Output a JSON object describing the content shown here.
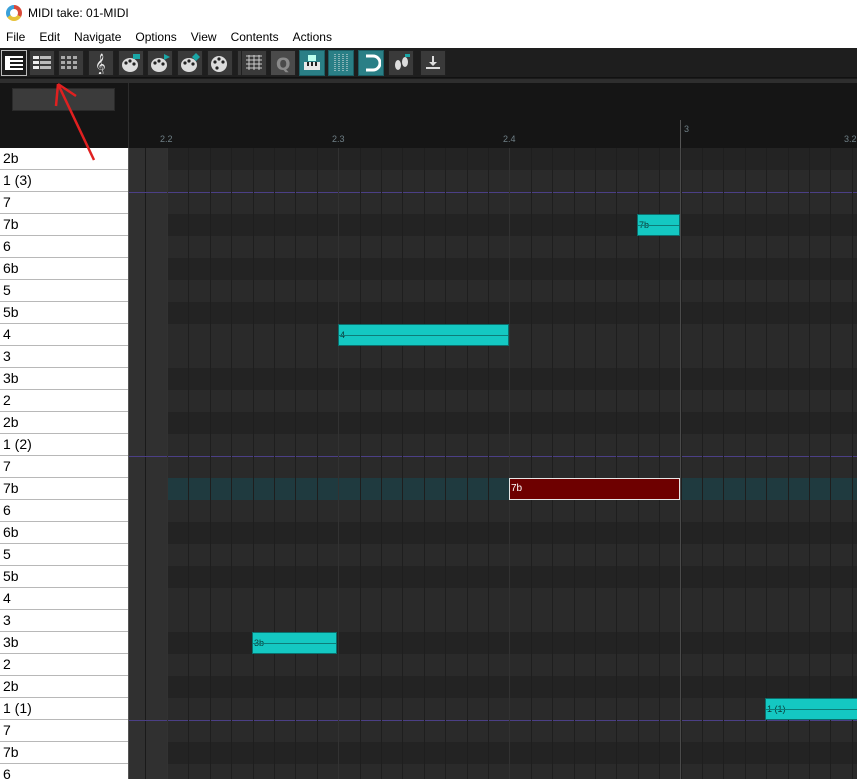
{
  "window": {
    "title": "MIDI take: 01-MIDI"
  },
  "menu": [
    "File",
    "Edit",
    "Navigate",
    "Options",
    "View",
    "Contents",
    "Actions"
  ],
  "toolbar": {
    "buttons": [
      {
        "name": "piano-roll-view",
        "icon": "piano-keys-icon"
      },
      {
        "name": "named-notes-view",
        "icon": "named-notes-icon"
      },
      {
        "name": "drum-grid-view",
        "icon": "drum-grid-icon"
      },
      {
        "name": "notation-view",
        "icon": "treble-clef-icon"
      },
      {
        "name": "midi-editor-action-1",
        "icon": "palette-icon"
      },
      {
        "name": "midi-editor-action-2",
        "icon": "palette-icon"
      },
      {
        "name": "midi-editor-action-3",
        "icon": "palette-icon"
      },
      {
        "name": "color-notes",
        "icon": "palette-icon"
      },
      {
        "name": "note-names",
        "icon": "note-names-icon"
      },
      {
        "name": "note-grid",
        "icon": "grid-icon"
      },
      {
        "name": "quantize",
        "icon": "q-icon"
      },
      {
        "name": "step-input",
        "icon": "piano-icon"
      },
      {
        "name": "grid-snap",
        "icon": "grid-lines-icon"
      },
      {
        "name": "snap-magnet",
        "icon": "magnet-icon"
      },
      {
        "name": "footprint-action",
        "icon": "footprint-icon"
      },
      {
        "name": "insert-action",
        "icon": "insert-icon"
      }
    ]
  },
  "ruler": {
    "labels": [
      "2.2",
      "2.3",
      "2.4",
      "3",
      "3.2"
    ]
  },
  "keys": [
    "2b",
    "1 (3)",
    "7",
    "7b",
    "6",
    "6b",
    "5",
    "5b",
    "4",
    "3",
    "3b",
    "2",
    "2b",
    "1 (2)",
    "7",
    "7b",
    "6",
    "6b",
    "5",
    "5b",
    "4",
    "3",
    "3b",
    "2",
    "2b",
    "1 (1)",
    "7",
    "7b",
    "6"
  ],
  "notes": [
    {
      "row": 3,
      "start": 2.475,
      "end": 2.5,
      "label": "7b",
      "selected": false
    },
    {
      "row": 8,
      "start": 2.3,
      "end": 2.4,
      "label": "4",
      "selected": false
    },
    {
      "row": 15,
      "start": 2.4,
      "end": 2.5,
      "label": "7b",
      "selected": true
    },
    {
      "row": 22,
      "start": 2.25,
      "end": 2.3,
      "label": "3b",
      "selected": false
    },
    {
      "row": 25,
      "start": 3.05,
      "end": 3.15,
      "label": "1 (1)",
      "selected": false
    }
  ],
  "colors": {
    "note": "#14c8c2",
    "selected_note": "#6e0000",
    "octave_line": "#4b3f86",
    "annotation_arrow": "#e02020"
  }
}
